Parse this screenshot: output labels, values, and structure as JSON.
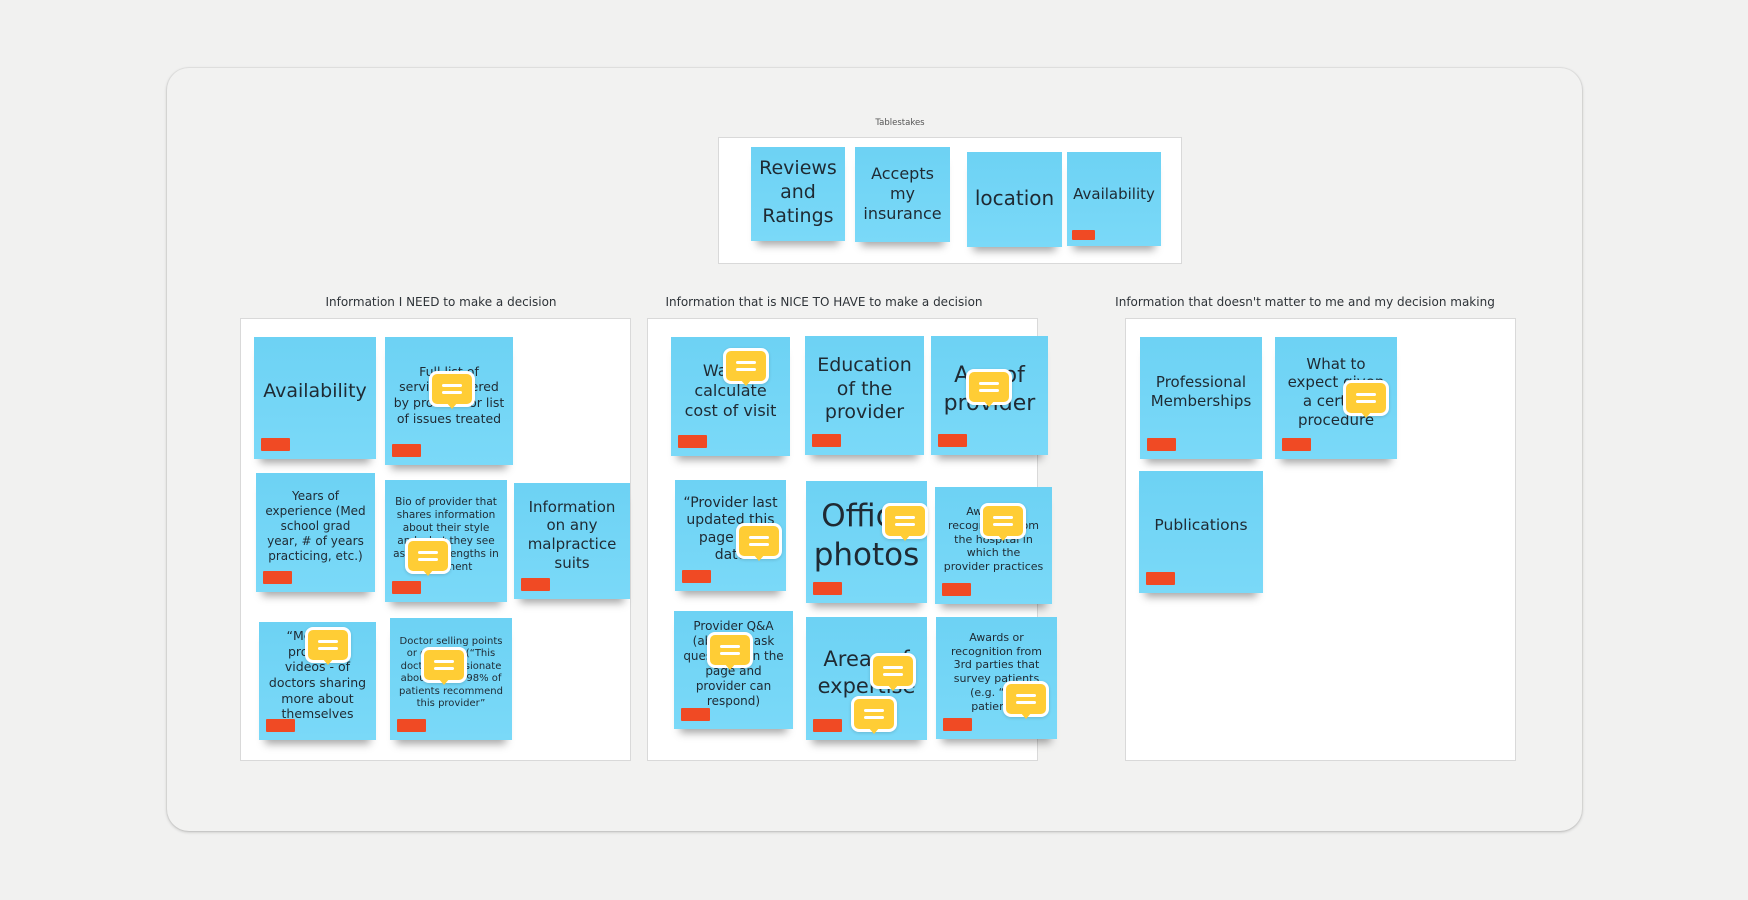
{
  "board": {
    "groups": {
      "tablestakes": {
        "title": "Tablestakes",
        "notes": [
          {
            "text": "Reviews and Ratings"
          },
          {
            "text": "Accepts my insurance"
          },
          {
            "text": "location"
          },
          {
            "text": "Availability"
          }
        ]
      },
      "need": {
        "title": "Information I NEED to make a decision",
        "notes": [
          {
            "text": "Availability"
          },
          {
            "text": "Full list of services offered by provider or list of issues treated"
          },
          {
            "text": "Years of experience (Med school grad year, # of years practicing, etc.)"
          },
          {
            "text": "Bio of provider that shares information about their style and what they see as their strengths in treatment"
          },
          {
            "text": "Information on any malpractice suits"
          },
          {
            "text": "“Meet the provider” videos - of doctors sharing more about themselves"
          },
          {
            "text": "Doctor selling points or qualities (“This doctor is passionate about…” or “98% of patients recommend this provider”"
          }
        ]
      },
      "nice": {
        "title": "Information that is NICE TO HAVE to make a decision",
        "notes": [
          {
            "text": "Way to calculate cost of visit"
          },
          {
            "text": "Education of the provider"
          },
          {
            "text": "Age of provider"
          },
          {
            "text": "“Provider last updated this page on” date"
          },
          {
            "text": "Office photos"
          },
          {
            "text": "Awards or recognition from the hospital in which the provider practices"
          },
          {
            "text": "Provider Q&A (ability to ask questions on the page and provider can respond)"
          },
          {
            "text": "Areas of expertise"
          },
          {
            "text": "Awards or recognition from 3rd parties that survey patients (e.g. “Top patients”"
          }
        ]
      },
      "doesnt_matter": {
        "title": "Information that doesn't matter to me and my decision making",
        "notes": [
          {
            "text": "Professional Memberships"
          },
          {
            "text": "What to expect given a certain procedure"
          },
          {
            "text": "Publications"
          }
        ]
      }
    },
    "colors": {
      "sticky": "#74d6f6",
      "tag": "#f04a24",
      "comment": "#ffcd35",
      "canvas": "#f2f2f1"
    }
  }
}
